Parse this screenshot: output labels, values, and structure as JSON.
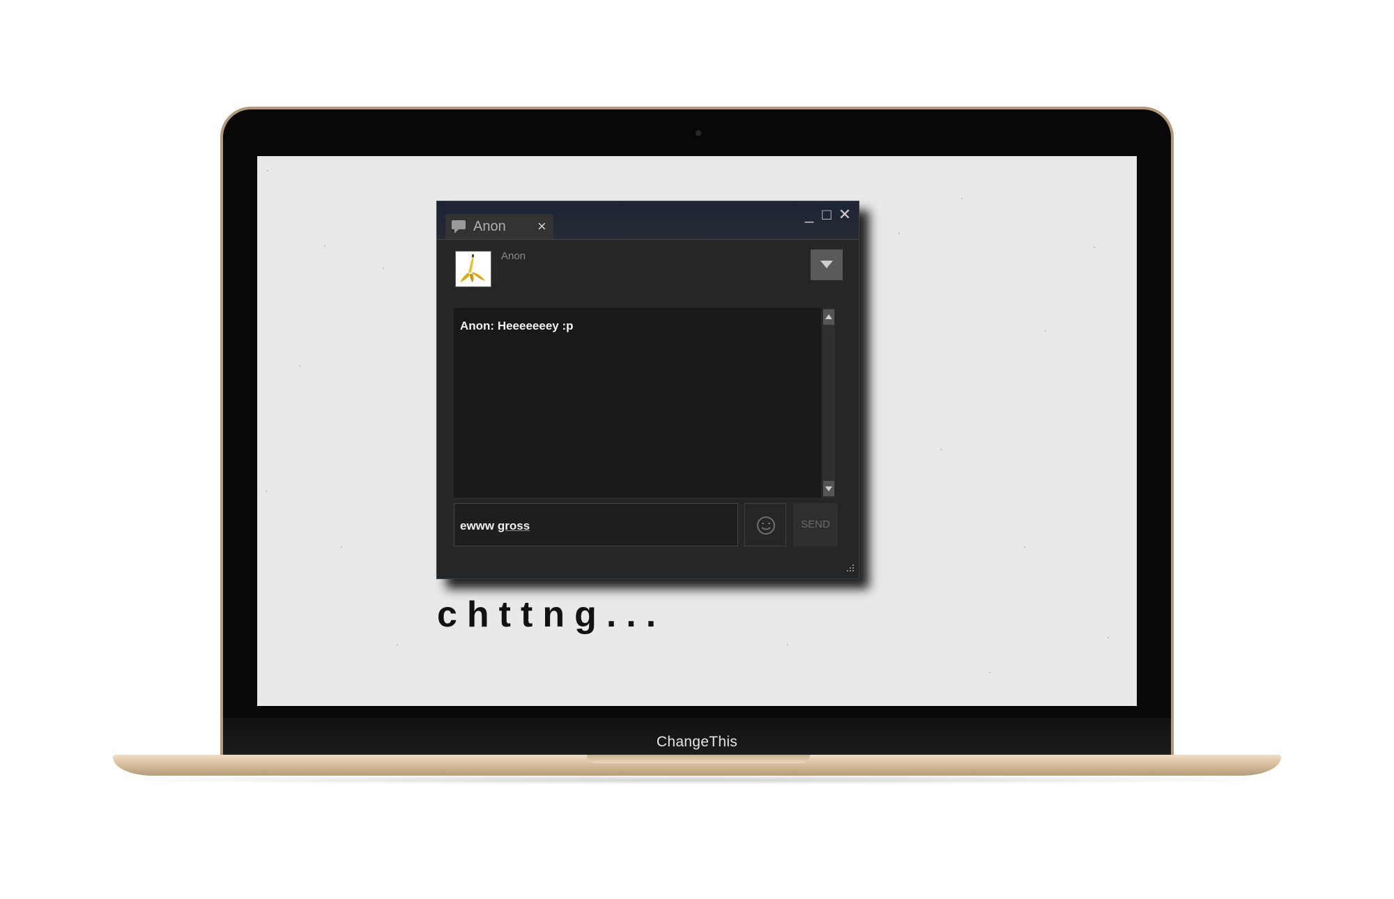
{
  "laptop": {
    "brand_label": "ChangeThis"
  },
  "chat": {
    "tab": {
      "label": "Anon",
      "close_glyph": "×",
      "icon": "speech-bubble-icon"
    },
    "window_controls": {
      "minimize_glyph": "_",
      "maximize_glyph": "□",
      "close_glyph": "✕"
    },
    "friend": {
      "name": "Anon",
      "avatar": "banana-peel-avatar"
    },
    "messages": [
      {
        "text": "Anon: Heeeeeeey :p"
      }
    ],
    "input": {
      "value_prefix": "ewww ",
      "value_underlined": "gross"
    },
    "send_label": "SEND",
    "emoji_icon": "smiley-icon"
  },
  "caption": "chttng..."
}
